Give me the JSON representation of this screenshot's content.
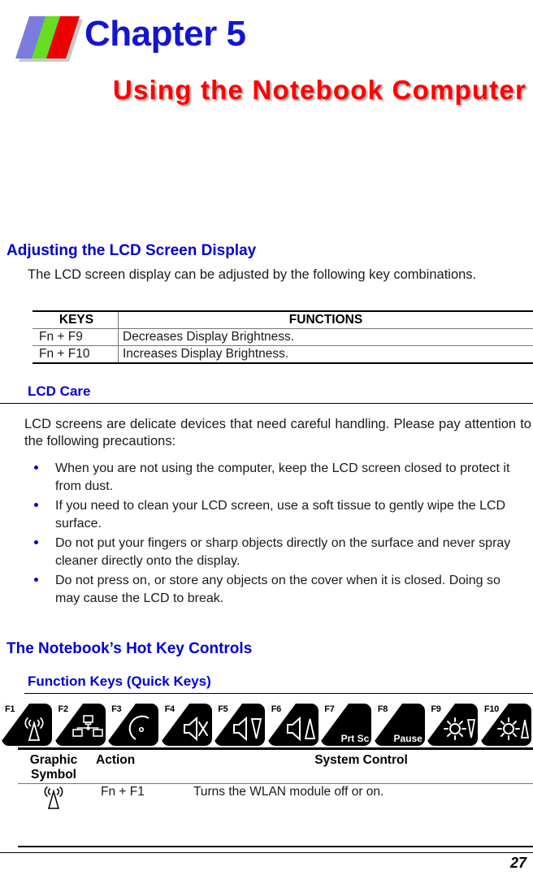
{
  "header": {
    "chapter_label": "Chapter 5",
    "chapter_title": "Using the Notebook Computer",
    "logo_colors": [
      "#7b7be0",
      "#66dd22",
      "#ee0000"
    ],
    "chapter_label_color": "#1414d2",
    "chapter_title_color": "#ff0000"
  },
  "sections": {
    "adjusting": {
      "heading": "Adjusting the LCD Screen Display",
      "paragraph": "The LCD screen display can be adjusted by the following key combinations.",
      "table": {
        "headers": [
          "KEYS",
          "FUNCTIONS"
        ],
        "rows": [
          [
            "Fn + F9",
            "Decreases Display Brightness."
          ],
          [
            "Fn + F10",
            "Increases Display Brightness."
          ]
        ]
      }
    },
    "lcd_care": {
      "heading": "LCD Care",
      "paragraph": "LCD screens are delicate devices that need careful handling.  Please pay attention to the following precautions:",
      "bullets": [
        "When you are not using the computer, keep the LCD screen closed to protect it from dust.",
        "If you need to clean your LCD screen, use a soft tissue to gently wipe the LCD surface.",
        "Do not put your fingers or sharp objects directly on the surface and never spray cleaner directly onto the display.",
        "Do not press on, or store any objects on the cover when it is closed.  Doing so may cause the LCD to break."
      ]
    },
    "hot_keys": {
      "heading": "The Notebook’s Hot Key Controls",
      "subheading": "Function Keys (Quick Keys)",
      "keys": [
        {
          "label": "F1",
          "icon": "wireless-antenna-icon",
          "text": ""
        },
        {
          "label": "F2",
          "icon": "network-lan-icon",
          "text": ""
        },
        {
          "label": "F3",
          "icon": "moon-sleep-icon",
          "text": ""
        },
        {
          "label": "F4",
          "icon": "speaker-mute-icon",
          "text": ""
        },
        {
          "label": "F5",
          "icon": "volume-down-icon",
          "text": ""
        },
        {
          "label": "F6",
          "icon": "volume-up-icon",
          "text": ""
        },
        {
          "label": "F7",
          "icon": "",
          "text": "Prt Sc"
        },
        {
          "label": "F8",
          "icon": "",
          "text": "Pause"
        },
        {
          "label": "F9",
          "icon": "brightness-down-icon",
          "text": ""
        },
        {
          "label": "F10",
          "icon": "brightness-up-icon",
          "text": ""
        }
      ],
      "table": {
        "headers": [
          "Graphic Symbol",
          "Action",
          "System Control"
        ],
        "header_lines": {
          "col1_line1": "Graphic",
          "col1_line2": "Symbol",
          "col2": "Action",
          "col3": "System Control"
        },
        "rows": [
          {
            "symbol_icon": "wireless-antenna-icon",
            "action": "Fn + F1",
            "control": "Turns the WLAN module off or on."
          }
        ]
      }
    }
  },
  "footer": {
    "page_number": "27"
  }
}
